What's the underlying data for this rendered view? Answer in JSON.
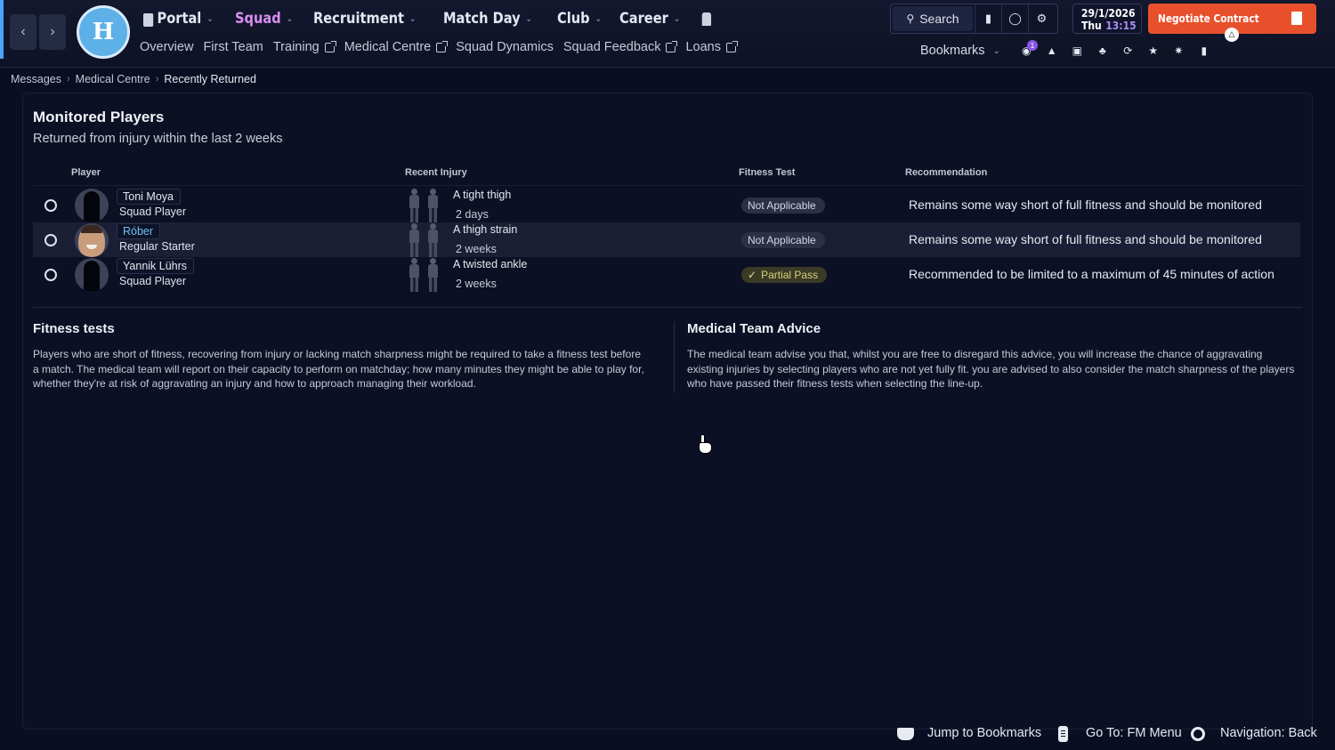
{
  "header": {
    "main_nav": [
      {
        "label": "Portal",
        "active": false
      },
      {
        "label": "Squad",
        "active": true
      },
      {
        "label": "Recruitment",
        "active": false
      },
      {
        "label": "Match Day",
        "active": false
      },
      {
        "label": "Club",
        "active": false
      },
      {
        "label": "Career",
        "active": false
      }
    ],
    "sub_nav": [
      {
        "label": "Overview"
      },
      {
        "label": "First Team"
      },
      {
        "label": "Training"
      },
      {
        "label": "Medical Centre"
      },
      {
        "label": "Squad Dynamics"
      },
      {
        "label": "Squad Feedback"
      },
      {
        "label": "Loans"
      }
    ],
    "search_label": "Search",
    "date": "29/1/2026",
    "day": "Thu",
    "time": "13:15",
    "negotiate_label": "Negotiate Contract",
    "bookmarks_label": "Bookmarks",
    "notification_count": "1",
    "colors": {
      "active_nav": "#d98ef0",
      "negotiate_bg": "#e8502c",
      "link": "#6fc3ef"
    }
  },
  "breadcrumb": [
    "Messages",
    "Medical Centre",
    "Recently Returned"
  ],
  "panel": {
    "title": "Monitored Players",
    "subtitle": "Returned from injury within the last 2 weeks",
    "columns": {
      "player": "Player",
      "injury": "Recent Injury",
      "fitness": "Fitness Test",
      "recommendation": "Recommendation"
    },
    "rows": [
      {
        "name": "Toni Moya",
        "role": "Squad Player",
        "injury": "A tight thigh",
        "duration": "2 days",
        "fitness": "Not Applicable",
        "recommendation": "Remains some way short of full fitness and should be monitored"
      },
      {
        "name": "Róber",
        "role": "Regular Starter",
        "injury": "A thigh strain",
        "duration": "2 weeks",
        "fitness": "Not Applicable",
        "recommendation": "Remains some way short of full fitness and should be monitored"
      },
      {
        "name": "Yannik Lührs",
        "role": "Squad Player",
        "injury": "A twisted ankle",
        "duration": "2 weeks",
        "fitness": "Partial Pass",
        "recommendation": "Recommended to be limited to a maximum of 45 minutes of action"
      }
    ],
    "fitness_tests": {
      "title": "Fitness tests",
      "text": "Players who are short of fitness, recovering from injury or lacking match sharpness might be required to take a fitness test before a match. The medical team will report on their capacity to perform on matchday; how many minutes they might be able to play for, whether they're at risk of aggravating an injury and how to approach managing their workload."
    },
    "medical_advice": {
      "title": "Medical Team Advice",
      "text": "The medical team advise you that, whilst you  are free to disregard this advice, you  will increase the chance of aggravating existing injuries by selecting players who are not yet fully fit.  you are advised to also consider the match sharpness of the players who have passed their fitness tests when selecting the line-up."
    }
  },
  "footer": {
    "jump": "Jump to Bookmarks",
    "goto": "Go To: FM Menu",
    "back": "Navigation: Back"
  }
}
